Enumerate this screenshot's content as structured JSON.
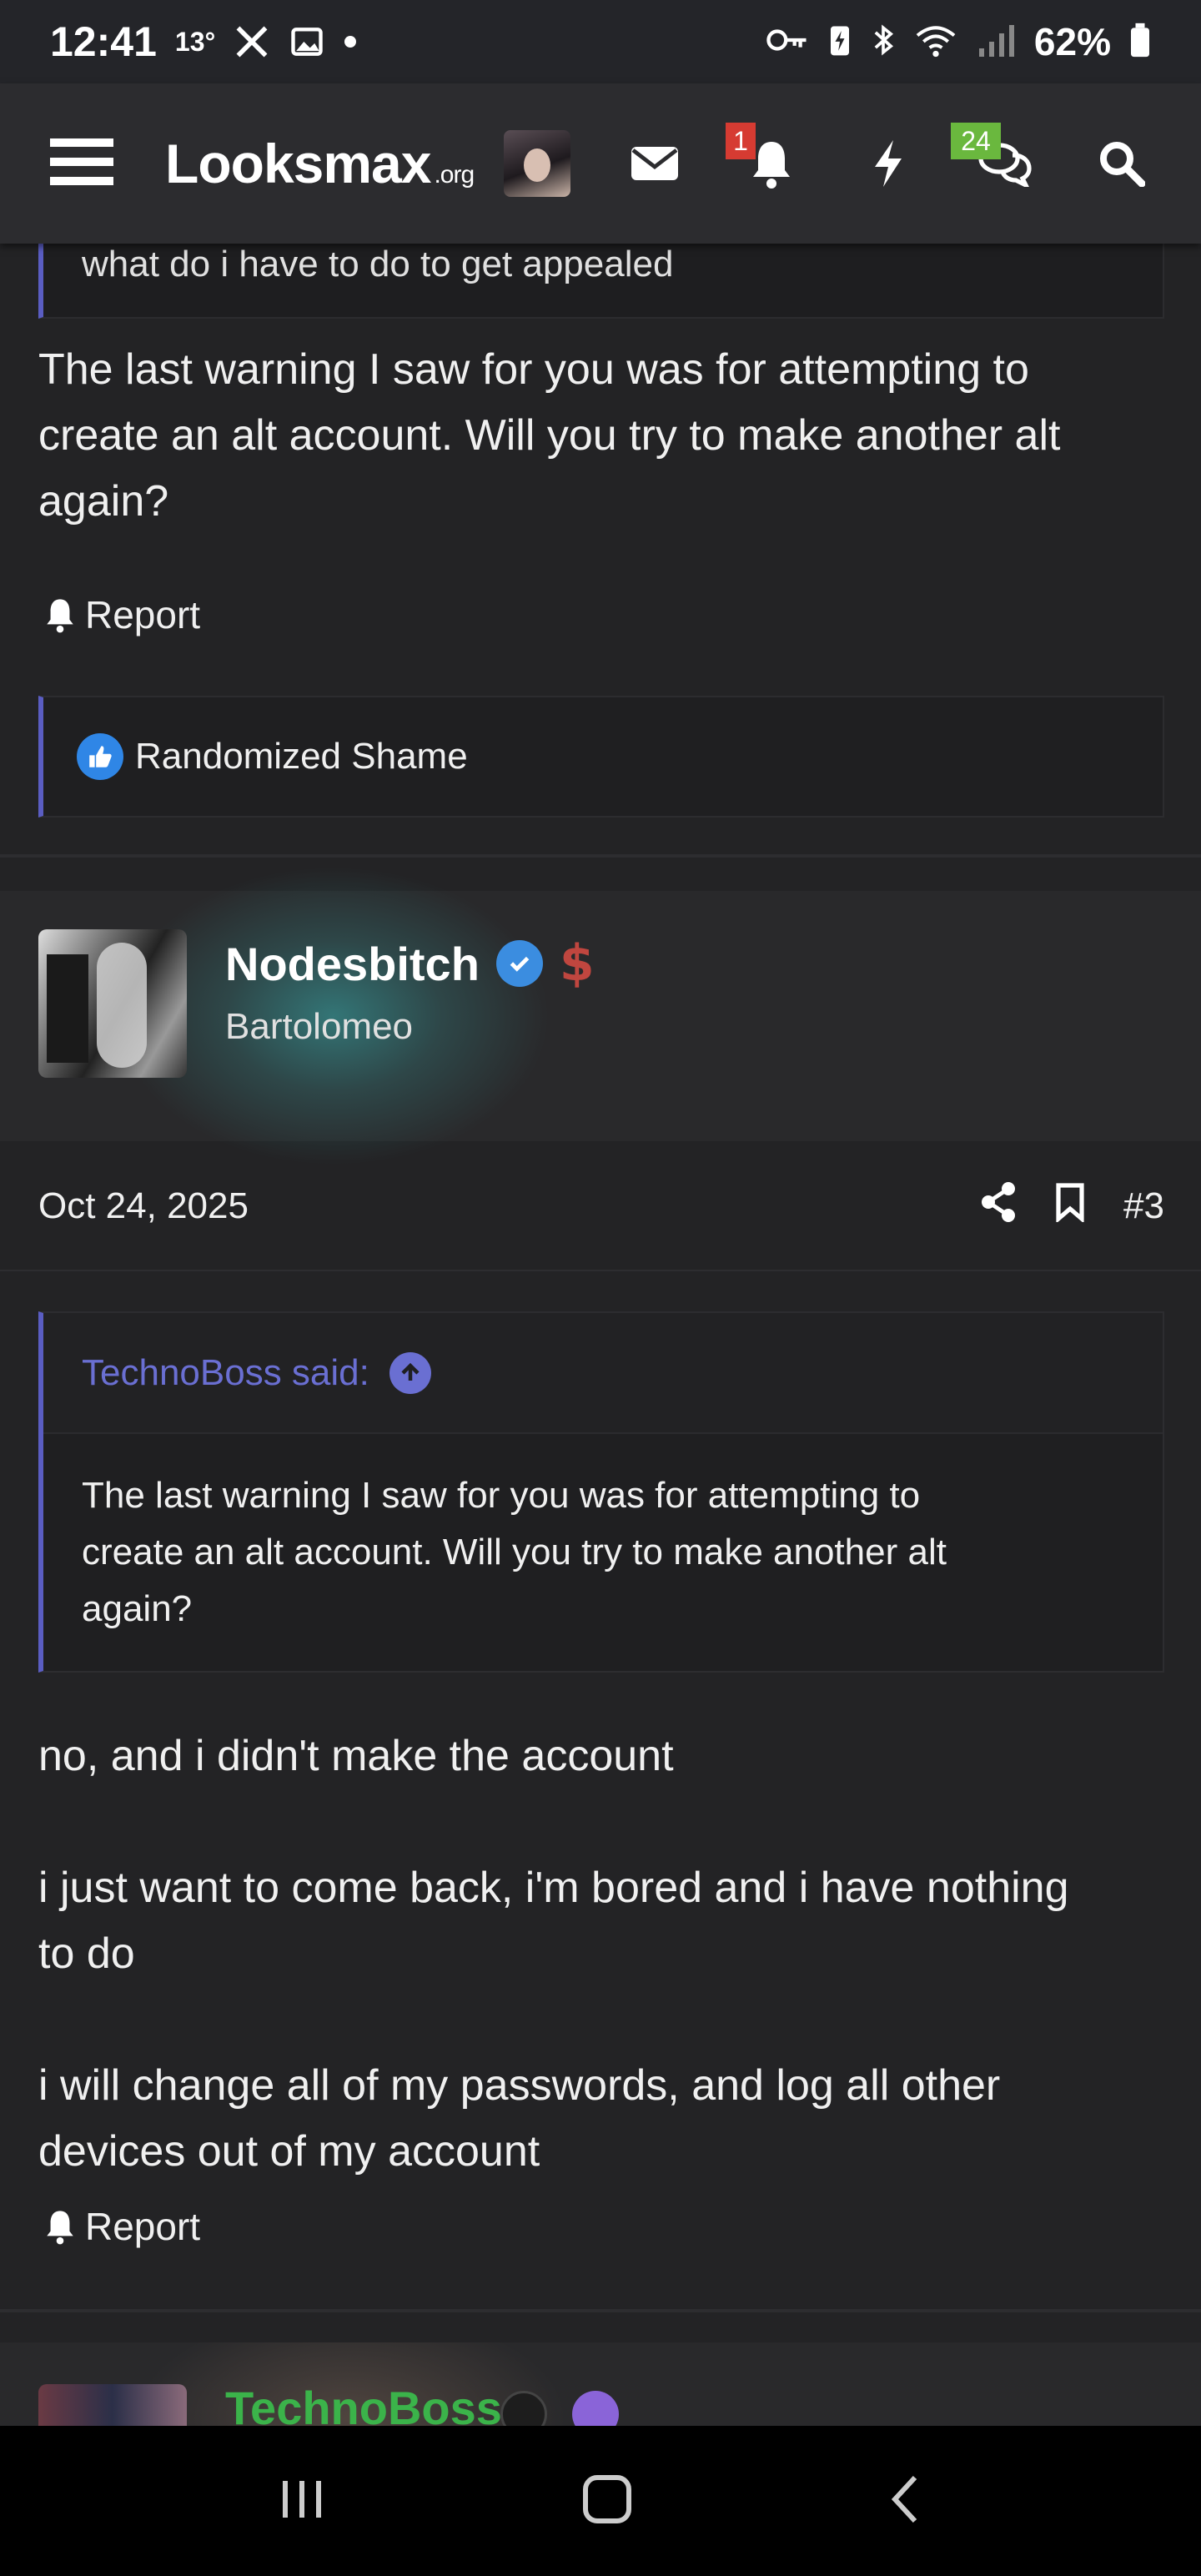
{
  "status_bar": {
    "time": "12:41",
    "temperature": "13°",
    "battery": "62%"
  },
  "header": {
    "logo_text": "Looksmax",
    "logo_suffix": ".org",
    "alerts_badge": "1",
    "conversations_badge": "24"
  },
  "previous_post": {
    "quote_tail": "what do i have to do to get appealed",
    "body": "The last warning I saw for you was for attempting to\ncreate an alt account. Will you try to make another alt\nagain?",
    "report_label": "Report",
    "reaction_label": "Randomized Shame"
  },
  "post": {
    "username": "Nodesbitch",
    "user_title": "Bartolomeo",
    "date": "Oct 24, 2025",
    "post_number": "#3",
    "quote": {
      "author_line": "TechnoBoss said:",
      "text": "The last warning I saw for you was for attempting to\ncreate an alt account. Will you try to make another alt\nagain?"
    },
    "body": "no, and i didn't make the account\n\ni just want to come back, i'm bored and i have nothing\nto do\n\ni will change all of my passwords, and log all other\ndevices out of my account",
    "report_label": "Report"
  },
  "next_post": {
    "username": "TechnoBoss"
  },
  "colors": {
    "accent": "#5a5dc2",
    "quote_author": "#6a6fd2",
    "alert_badge": "#d63b32",
    "conversation_badge": "#6ab83e",
    "next_username": "#3bb34a"
  }
}
